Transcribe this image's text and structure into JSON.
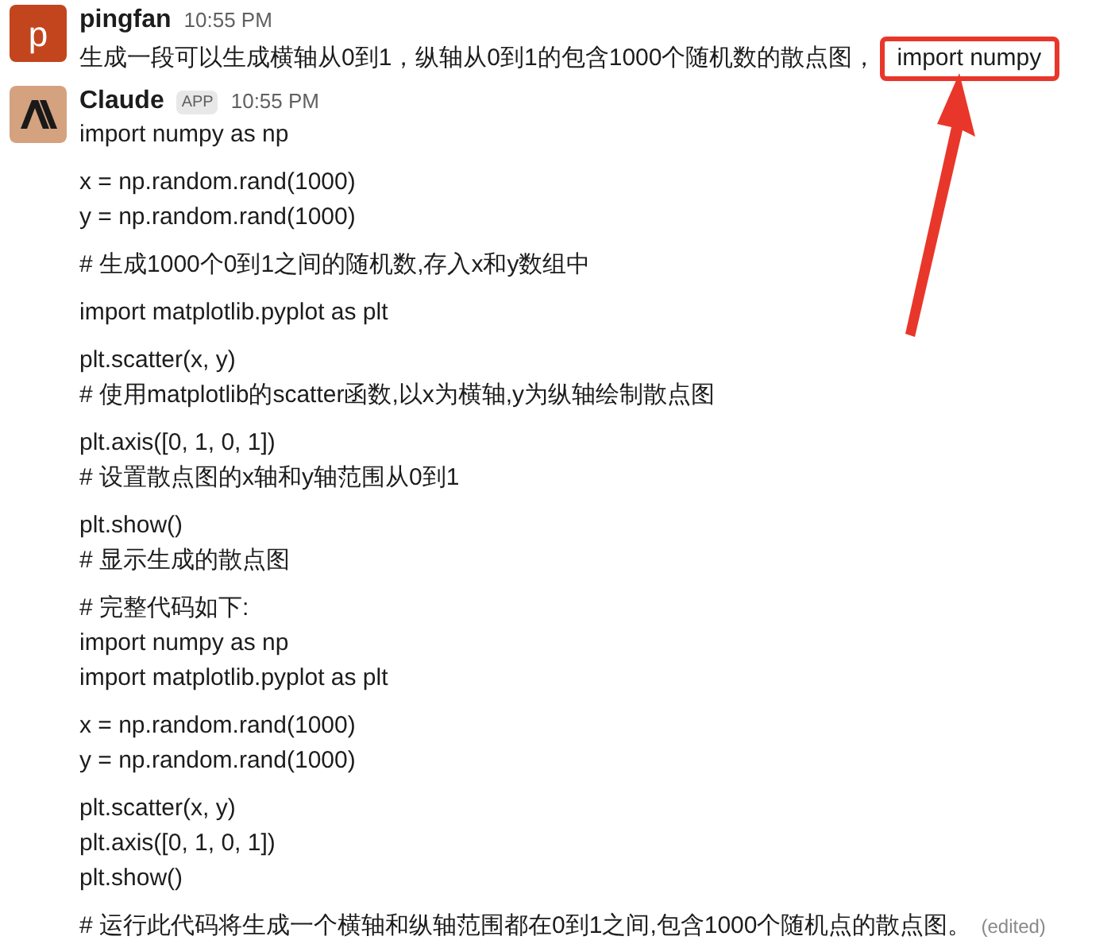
{
  "messages": [
    {
      "kind": "user",
      "author": "pingfan",
      "time": "10:55 PM",
      "avatar_letter": "p",
      "text": "生成一段可以生成横轴从0到1，纵轴从0到1的包含1000个随机数的散点图，",
      "highlight": "import numpy"
    },
    {
      "kind": "bot",
      "author": "Claude",
      "badge": "APP",
      "time": "10:55 PM",
      "edited": "(edited)",
      "paragraphs": [
        [
          "import numpy as np"
        ],
        [
          "x = np.random.rand(1000)",
          "y = np.random.rand(1000)"
        ],
        [
          "# 生成1000个0到1之间的随机数,存入x和y数组中"
        ],
        [
          "import matplotlib.pyplot as plt"
        ],
        [
          "plt.scatter(x, y)",
          "# 使用matplotlib的scatter函数,以x为横轴,y为纵轴绘制散点图"
        ],
        [
          "plt.axis([0, 1, 0, 1])",
          "# 设置散点图的x轴和y轴范围从0到1"
        ],
        [
          "plt.show()",
          "# 显示生成的散点图"
        ],
        [
          "# 完整代码如下:",
          "import numpy as np",
          "import matplotlib.pyplot as plt"
        ],
        [
          "x = np.random.rand(1000)",
          "y = np.random.rand(1000)"
        ],
        [
          "plt.scatter(x, y)",
          "plt.axis([0, 1, 0, 1])",
          "plt.show()"
        ],
        [
          "# 运行此代码将生成一个横轴和纵轴范围都在0到1之间,包含1000个随机点的散点图。"
        ]
      ]
    }
  ]
}
